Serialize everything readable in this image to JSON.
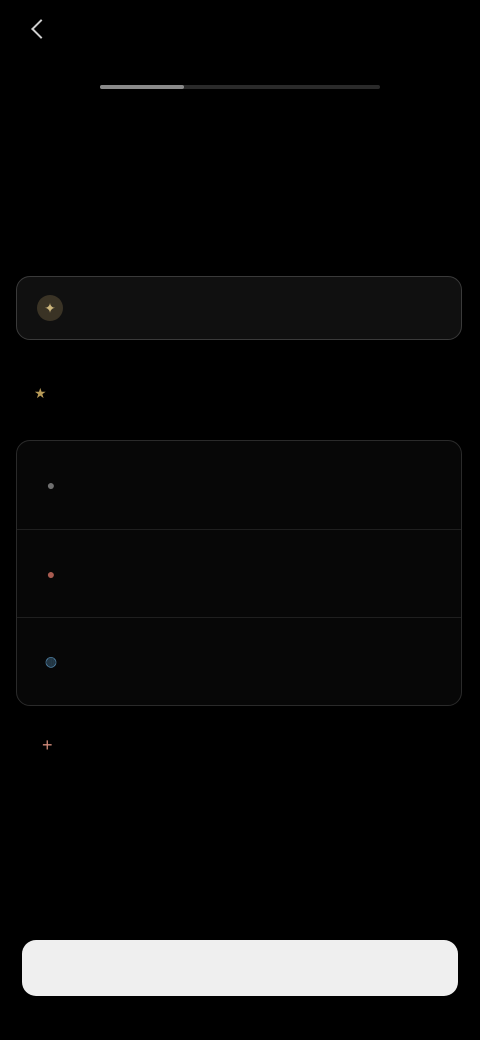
{
  "header": {
    "back_label": "",
    "skip_label": ""
  },
  "progress": {
    "value": 0.3
  },
  "main": {
    "title": "",
    "subtitle": ""
  },
  "primary_option": {
    "label": "",
    "icon": "sparkle-icon"
  },
  "section": {
    "label": "",
    "icon": "star-icon"
  },
  "options": [
    {
      "label": "",
      "icon": "dot-icon"
    },
    {
      "label": "",
      "icon": "dot-icon"
    },
    {
      "label": "",
      "icon": "globe-icon"
    }
  ],
  "more": {
    "label": "",
    "icon": "plus-icon"
  },
  "cta": {
    "label": ""
  },
  "colors": {
    "background": "#000000",
    "accent_gold": "#cdb67c",
    "accent_red": "#d08a7a",
    "cta_bg": "#efefef"
  }
}
